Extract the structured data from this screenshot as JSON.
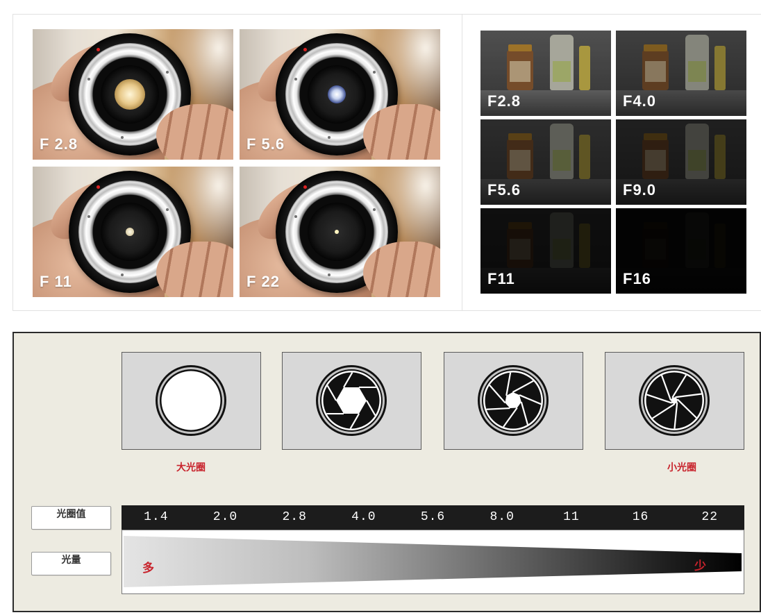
{
  "lens_photos": {
    "items": [
      {
        "label": "F 2.8"
      },
      {
        "label": "F 5.6"
      },
      {
        "label": "F 11"
      },
      {
        "label": "F 22"
      }
    ]
  },
  "exposure_photos": {
    "items": [
      {
        "label": "F2.8"
      },
      {
        "label": "F4.0"
      },
      {
        "label": "F5.6"
      },
      {
        "label": "F9.0"
      },
      {
        "label": "F11"
      },
      {
        "label": "F16"
      }
    ]
  },
  "aperture_diagram": {
    "icons": [
      "aperture-open-icon",
      "aperture-hexagon-icon",
      "aperture-mid-icon",
      "aperture-small-icon"
    ],
    "large_aperture_label": "大光圈",
    "small_aperture_label": "小光圈",
    "f_value_row_label": "光圈值",
    "light_row_label": "光量",
    "f_values": [
      "1.4",
      "2.0",
      "2.8",
      "4.0",
      "5.6",
      "8.0",
      "11",
      "16",
      "22"
    ],
    "light_more_label": "多",
    "light_less_label": "少"
  },
  "colors": {
    "label_red": "#c8232c",
    "scale_bar": "#1c1c1c",
    "diagram_background": "#edebe1"
  }
}
